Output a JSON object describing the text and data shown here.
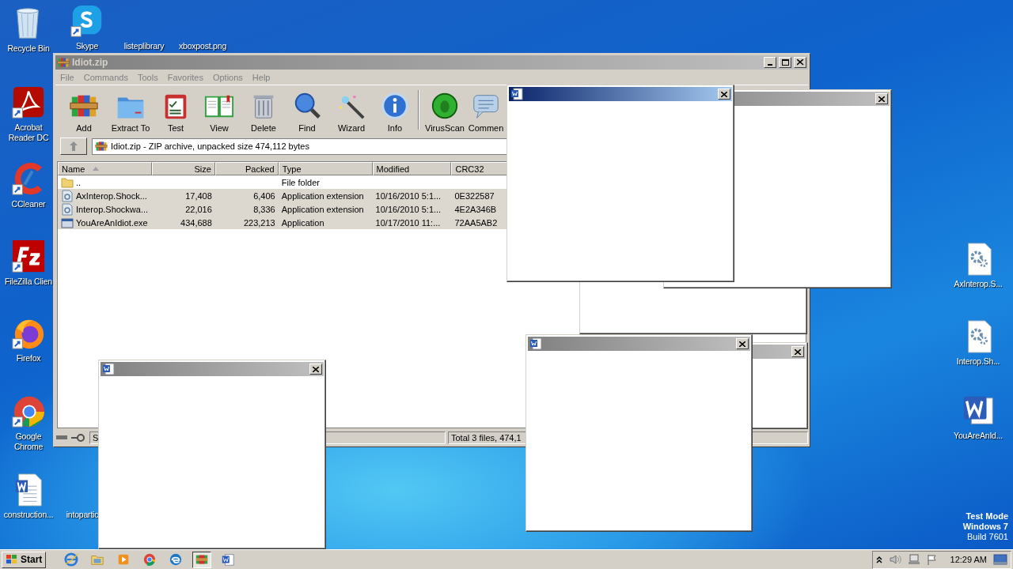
{
  "desktop": {
    "icons": [
      {
        "label": "Recycle Bin"
      },
      {
        "label": "Skype"
      },
      {
        "label": "listeplibrary"
      },
      {
        "label": "xboxpost.png"
      },
      {
        "label": "Acrobat Reader DC"
      },
      {
        "label": "CCleaner"
      },
      {
        "label": "FileZilla Clien"
      },
      {
        "label": "Firefox"
      },
      {
        "label": "Google Chrome"
      },
      {
        "label": "construction..."
      },
      {
        "label": "intopartic"
      },
      {
        "label": "AxInterop.S..."
      },
      {
        "label": "Interop.Sh..."
      },
      {
        "label": "YouAreAnId..."
      }
    ],
    "os_notice": [
      "Test Mode",
      "Windows 7",
      "Build 7601"
    ]
  },
  "archive_window": {
    "title": "Idiot.zip",
    "active": false,
    "menu": [
      "File",
      "Commands",
      "Tools",
      "Favorites",
      "Options",
      "Help"
    ],
    "toolbar": [
      "Add",
      "Extract To",
      "Test",
      "View",
      "Delete",
      "Find",
      "Wizard",
      "Info",
      "VirusScan",
      "Commen"
    ],
    "path": "Idiot.zip - ZIP archive, unpacked size 474,112 bytes",
    "columns": [
      {
        "label": "Name",
        "sorted": true
      },
      {
        "label": "Size",
        "sorted": false
      },
      {
        "label": "Packed",
        "sorted": false
      },
      {
        "label": "Type",
        "sorted": false
      },
      {
        "label": "Modified",
        "sorted": false
      },
      {
        "label": "CRC32",
        "sorted": false
      }
    ],
    "rows": [
      {
        "kind": "folder",
        "selected": false,
        "cells": [
          "..",
          "",
          "",
          "File folder",
          "",
          ""
        ]
      },
      {
        "kind": "library",
        "selected": true,
        "cells": [
          "AxInterop.Shock...",
          "17,408",
          "6,406",
          "Application extension",
          "10/16/2010 5:1...",
          "0E322587"
        ]
      },
      {
        "kind": "library",
        "selected": true,
        "cells": [
          "Interop.Shockwa...",
          "22,016",
          "8,336",
          "Application extension",
          "10/16/2010 5:1...",
          "4E2A346B"
        ]
      },
      {
        "kind": "program",
        "selected": true,
        "cells": [
          "YouAreAnIdiot.exe",
          "434,688",
          "223,213",
          "Application",
          "10/17/2010 11:...",
          "72AA5AB2"
        ]
      }
    ],
    "status": [
      "S",
      "Total 3 files, 474,1"
    ]
  },
  "popups": [
    {
      "kind": "blank"
    },
    {
      "kind": "blank",
      "active": false
    },
    {
      "kind": "blank",
      "active": false
    },
    {
      "kind": "blank",
      "active": true
    },
    {
      "kind": "blank",
      "active": false
    },
    {
      "kind": "blank",
      "active": false
    }
  ],
  "taskbar": {
    "start": "Start",
    "items": [
      {
        "selected": false
      },
      {
        "selected": false
      },
      {
        "selected": false
      },
      {
        "selected": false
      },
      {
        "selected": false
      },
      {
        "selected": true
      },
      {
        "selected": false
      }
    ],
    "clock": "12:29 AM"
  }
}
